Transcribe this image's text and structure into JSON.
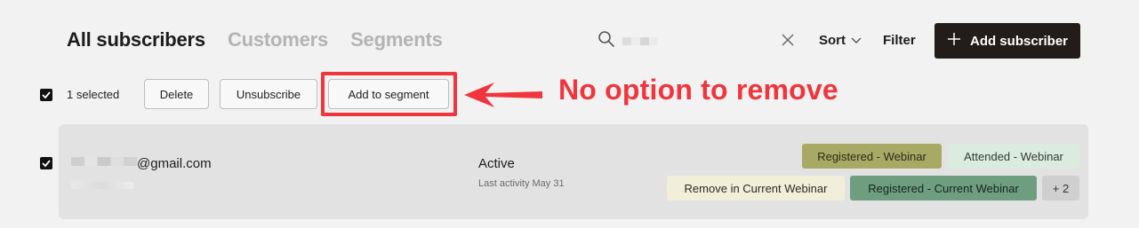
{
  "tabs": [
    {
      "label": "All subscribers",
      "active": true
    },
    {
      "label": "Customers",
      "active": false
    },
    {
      "label": "Segments",
      "active": false
    }
  ],
  "toolbar": {
    "sort_label": "Sort",
    "filter_label": "Filter",
    "add_subscriber_label": "Add subscriber",
    "add_subscriber_icon": "plus-icon"
  },
  "bulk": {
    "selected_text": "1 selected",
    "delete_label": "Delete",
    "unsubscribe_label": "Unsubscribe",
    "add_to_segment_label": "Add to segment"
  },
  "annotation": {
    "text": "No option to remove",
    "color": "#f0353d"
  },
  "subscriber": {
    "email_suffix": "@gmail.com",
    "status": "Active",
    "last_activity": "Last activity May 31",
    "tags": [
      {
        "label": "Registered - Webinar",
        "bg": "#a8a964",
        "fg": "#2b2b1a"
      },
      {
        "label": "Attended - Webinar",
        "bg": "#dcebe0",
        "fg": "#2f3a33"
      },
      {
        "label": "Remove in Current Webinar",
        "bg": "#f1efd9",
        "fg": "#2b2b22"
      },
      {
        "label": "Registered - Current Webinar",
        "bg": "#6f9d80",
        "fg": "#16261c"
      },
      {
        "label": "+ 2",
        "bg": "#cfcfcf",
        "fg": "#333333"
      }
    ]
  },
  "colors": {
    "primary_button": "#221c1b",
    "accent_red": "#f0353d"
  }
}
